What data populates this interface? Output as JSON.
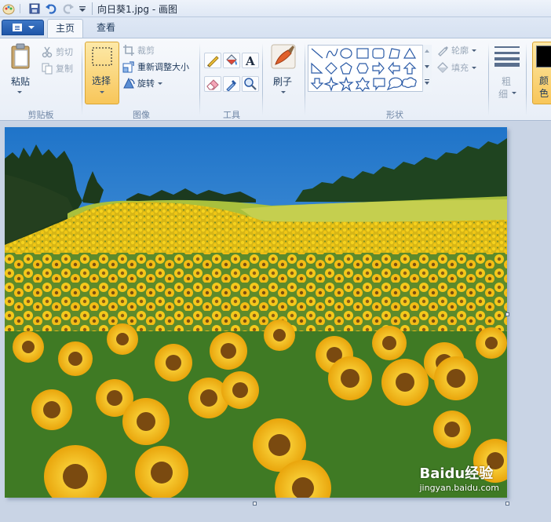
{
  "window": {
    "title": "向日葵1.jpg - 画图"
  },
  "tabs": [
    {
      "label": "主页",
      "active": true
    },
    {
      "label": "查看",
      "active": false
    }
  ],
  "ribbon": {
    "clipboard": {
      "paste_label": "粘贴",
      "cut_label": "剪切",
      "copy_label": "复制",
      "group_label": "剪贴板"
    },
    "image": {
      "select_label": "选择",
      "crop_label": "裁剪",
      "resize_label": "重新调整大小",
      "rotate_label": "旋转",
      "group_label": "图像"
    },
    "tools": {
      "group_label": "工具"
    },
    "brushes": {
      "label": "刷子"
    },
    "shapes": {
      "outline_label": "轮廓",
      "fill_label": "填充",
      "group_label": "形状"
    },
    "size": {
      "label_line1": "粗",
      "label_line2": "细"
    },
    "colors": {
      "label_line1": "颜",
      "label_line2": "色",
      "primary_color": "#000000"
    }
  },
  "colors": {
    "accent_select": "#f8c65a",
    "sky": "#3d8fd8",
    "sunflower": "#f2c21a"
  },
  "watermark": {
    "brand": "Baidu经验",
    "url": "jingyan.baidu.com"
  }
}
